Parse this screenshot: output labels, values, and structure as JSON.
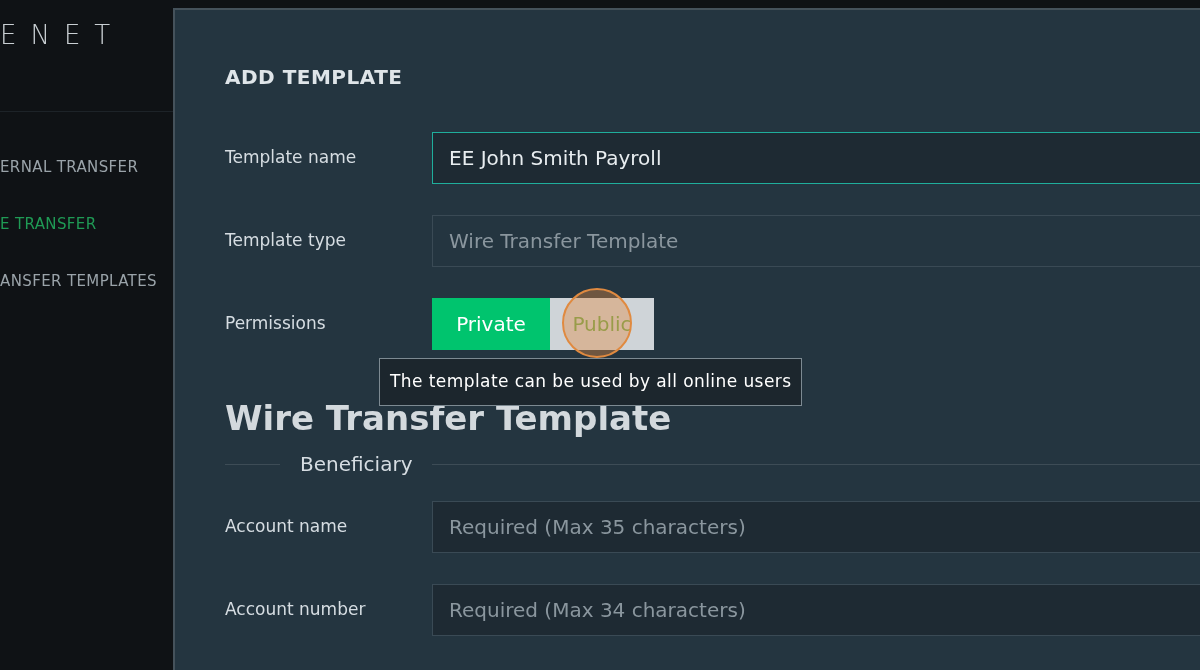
{
  "logo": "ENET",
  "sidebar": {
    "items": [
      {
        "label": "ERNAL TRANSFER",
        "selected": false
      },
      {
        "label": "E TRANSFER",
        "selected": true
      },
      {
        "label": "ANSFER TEMPLATES",
        "selected": false
      }
    ]
  },
  "modal": {
    "title": "ADD TEMPLATE",
    "fields": [
      {
        "kind": "input",
        "label": "Template name",
        "value": "EE John Smith Payroll",
        "focused": true,
        "disabled": false
      },
      {
        "kind": "input",
        "label": "Template type",
        "value": "Wire Transfer Template",
        "focused": false,
        "disabled": true
      },
      {
        "kind": "toggle",
        "label": "Permissions",
        "options": [
          {
            "label": "Private",
            "selected": true
          },
          {
            "label": "Public",
            "selected": false
          }
        ],
        "tooltip": "The template can be used by all online users"
      }
    ],
    "heading": "Wire Transfer Template",
    "section": "Beneficiary",
    "section_fields": [
      {
        "kind": "input",
        "label": "Account name",
        "placeholder": "Required (Max 35 characters)",
        "focused": false,
        "disabled": false
      },
      {
        "kind": "input",
        "label": "Account number",
        "placeholder": "Required (Max 34 characters)",
        "focused": false,
        "disabled": false
      }
    ]
  }
}
